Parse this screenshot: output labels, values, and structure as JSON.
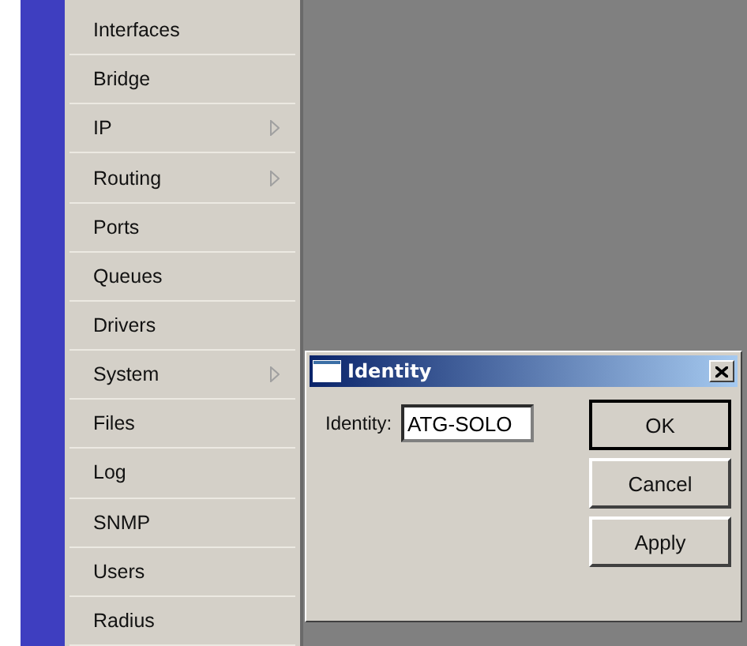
{
  "menu": {
    "items": [
      {
        "label": "Interfaces",
        "submenu": false
      },
      {
        "label": "Bridge",
        "submenu": false
      },
      {
        "label": "IP",
        "submenu": true
      },
      {
        "label": "Routing",
        "submenu": true
      },
      {
        "label": "Ports",
        "submenu": false
      },
      {
        "label": "Queues",
        "submenu": false
      },
      {
        "label": "Drivers",
        "submenu": false
      },
      {
        "label": "System",
        "submenu": true
      },
      {
        "label": "Files",
        "submenu": false
      },
      {
        "label": "Log",
        "submenu": false
      },
      {
        "label": "SNMP",
        "submenu": false
      },
      {
        "label": "Users",
        "submenu": false
      },
      {
        "label": "Radius",
        "submenu": false
      }
    ]
  },
  "dialog": {
    "title": "Identity",
    "field": {
      "label": "Identity:",
      "value": "ATG-SOLO"
    },
    "buttons": [
      {
        "label": "OK",
        "default": true
      },
      {
        "label": "Cancel",
        "default": false
      },
      {
        "label": "Apply",
        "default": false
      }
    ]
  }
}
